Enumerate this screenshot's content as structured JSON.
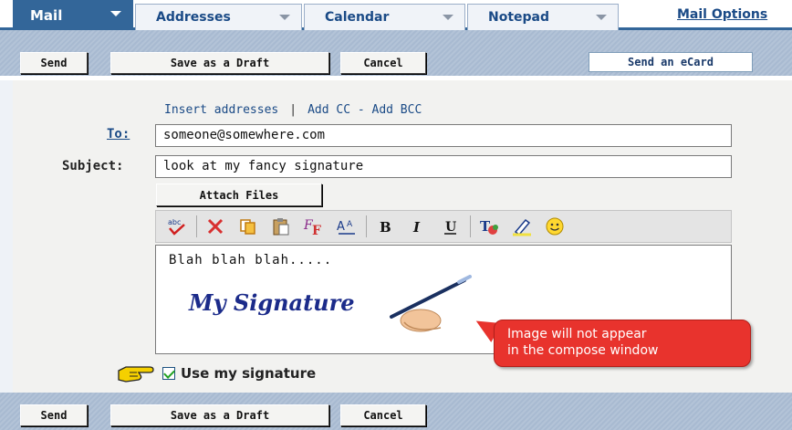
{
  "tabs": [
    {
      "label": "Mail",
      "active": true
    },
    {
      "label": "Addresses",
      "active": false
    },
    {
      "label": "Calendar",
      "active": false
    },
    {
      "label": "Notepad",
      "active": false
    }
  ],
  "mail_options_label": "Mail Options",
  "toolbar": {
    "send_label": "Send",
    "draft_label": "Save as a Draft",
    "cancel_label": "Cancel",
    "ecard_label": "Send an eCard"
  },
  "compose": {
    "insert_addresses_label": "Insert addresses",
    "separator": "|",
    "add_cc_bcc_label": "Add CC - Add BCC",
    "to_label": "To:",
    "to_value": "someone@somewhere.com",
    "subject_label": "Subject:",
    "subject_value": "look at my fancy signature",
    "attach_label": "Attach Files",
    "editor_toolbar_icons": [
      "spellcheck-icon",
      "cut-icon",
      "copy-icon",
      "paste-icon",
      "font-icon",
      "font-size-icon",
      "bold-icon",
      "italic-icon",
      "underline-icon",
      "text-color-icon",
      "highlight-icon",
      "smiley-icon"
    ],
    "body_text": "Blah blah blah.....",
    "signature_text": "My Signature",
    "callout_text_1": "Image will not appear",
    "callout_text_2": "in the compose window",
    "use_signature_label": "Use my signature",
    "use_signature_checked": true
  },
  "colors": {
    "active_tab": "#336699",
    "link": "#1a4a86",
    "callout": "#e8332d",
    "signature": "#1b2b8a"
  }
}
